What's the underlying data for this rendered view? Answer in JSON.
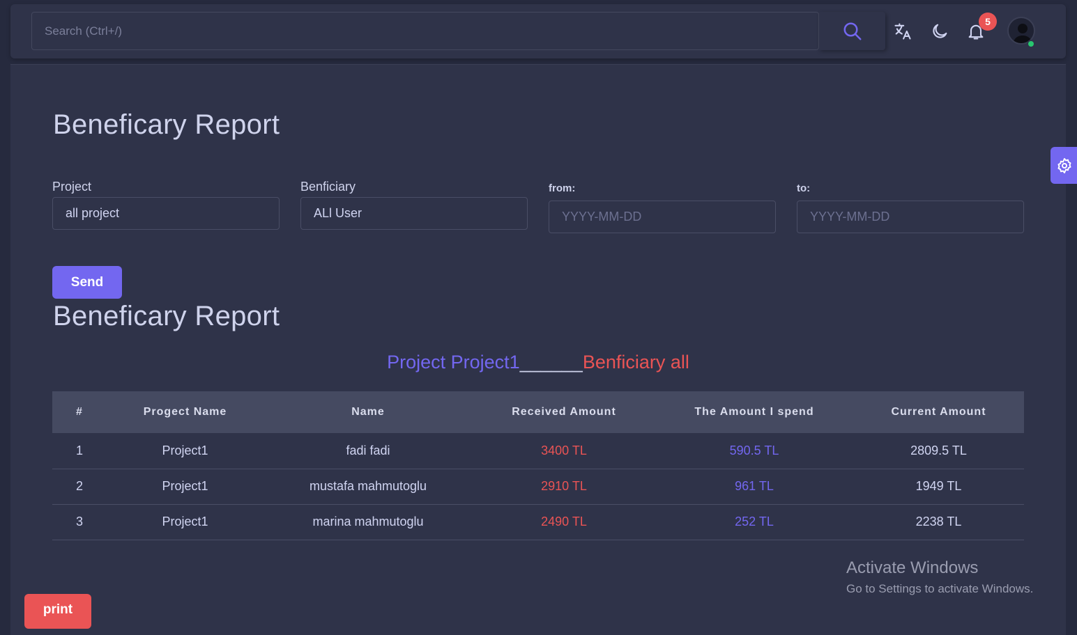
{
  "navbar": {
    "search_placeholder": "Search (Ctrl+/)",
    "notification_count": "5",
    "icons": [
      "search-icon",
      "translate-icon",
      "moon-icon",
      "bell-icon",
      "user-avatar"
    ]
  },
  "report": {
    "title": "Beneficary Report",
    "results_title": "Beneficary Report",
    "filters": {
      "project_label": "Project",
      "project_value": "all project",
      "beneficiary_label": "Benficiary",
      "beneficiary_value": "ALl User",
      "from_label": "from:",
      "from_placeholder": "YYYY-MM-DD",
      "to_label": "to:",
      "to_placeholder": "YYYY-MM-DD"
    },
    "send_label": "Send",
    "subtitle": {
      "project": "Project Project1",
      "separator": "______",
      "beneficiary": "Benficiary all"
    },
    "table": {
      "headers": [
        "#",
        "Progect Name",
        "Name",
        "Received Amount",
        "The Amount I spend",
        "Current Amount"
      ],
      "rows": [
        [
          "1",
          "Project1",
          "fadi fadi",
          "3400 TL",
          "590.5 TL",
          "2809.5 TL"
        ],
        [
          "2",
          "Project1",
          "mustafa mahmutoglu",
          "2910 TL",
          "961 TL",
          "1949 TL"
        ],
        [
          "3",
          "Project1",
          "marina mahmutoglu",
          "2490 TL",
          "252 TL",
          "2238 TL"
        ]
      ]
    },
    "print_label": "print"
  },
  "watermark": {
    "line1": "Activate Windows",
    "line2": "Go to Settings to activate Windows."
  },
  "colors": {
    "accent": "#7367f0",
    "danger": "#ea5455",
    "background": "#2f3349"
  }
}
